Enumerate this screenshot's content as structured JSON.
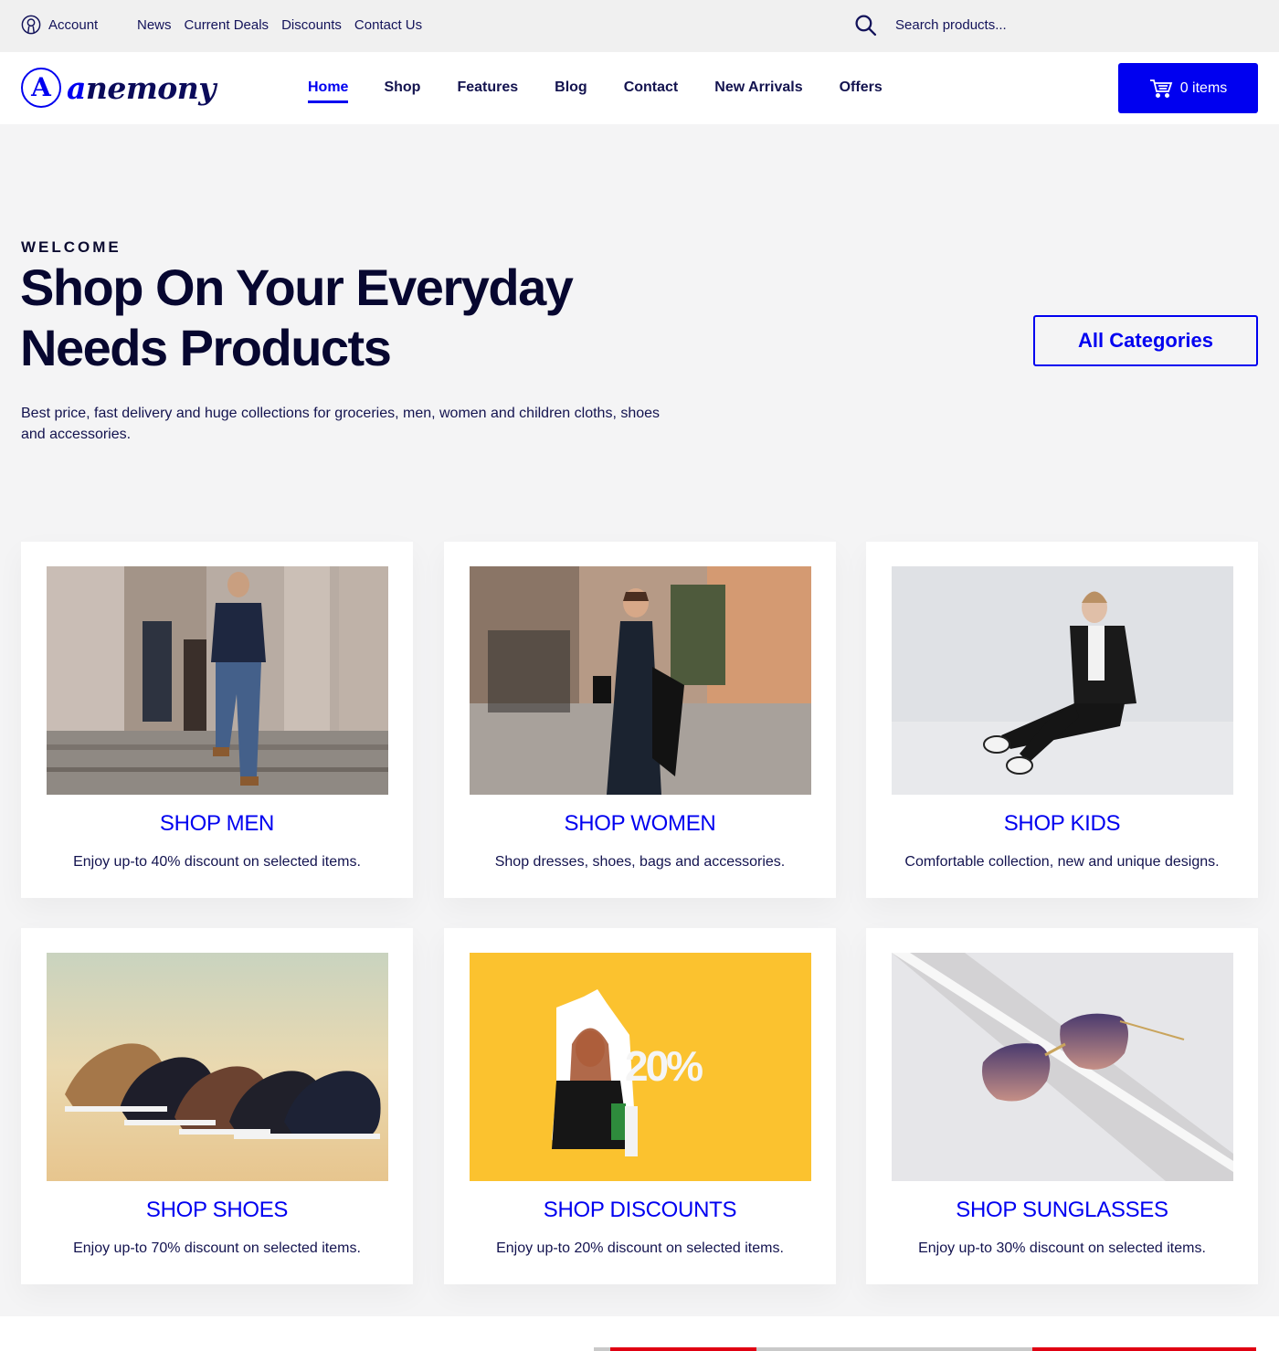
{
  "topbar": {
    "account_label": "Account",
    "links": [
      "News",
      "Current Deals",
      "Discounts",
      "Contact Us"
    ],
    "search_placeholder": "Search products..."
  },
  "header": {
    "logo_mark": "A",
    "logo_first": "a",
    "logo_rest": "nemony",
    "nav": [
      {
        "label": "Home",
        "active": true
      },
      {
        "label": "Shop",
        "active": false
      },
      {
        "label": "Features",
        "active": false
      },
      {
        "label": "Blog",
        "active": false
      },
      {
        "label": "Contact",
        "active": false
      },
      {
        "label": "New Arrivals",
        "active": false
      },
      {
        "label": "Offers",
        "active": false
      }
    ],
    "cart_label": "0 items"
  },
  "hero": {
    "eyebrow": "WELCOME",
    "title_line1": "Shop On Your Everyday",
    "title_line2": "Needs Products",
    "description": "Best price, fast delivery and huge collections for groceries, men, women and children cloths, shoes and accessories.",
    "cta_label": "All Categories"
  },
  "categories": [
    {
      "title": "SHOP MEN",
      "description": "Enjoy up-to 40% discount on selected items.",
      "image": "man walking down stone steps in blazer and jeans"
    },
    {
      "title": "SHOP WOMEN",
      "description": "Shop dresses, shoes, bags and accessories.",
      "image": "woman in sunglasses and dark dress on city street"
    },
    {
      "title": "SHOP KIDS",
      "description": "Comfortable collection, new and unique designs.",
      "image": "girl in black suit sitting on floor"
    },
    {
      "title": "SHOP SHOES",
      "description": "Enjoy up-to 70% discount on selected items.",
      "image": "row of five sneakers"
    },
    {
      "title": "SHOP DISCOUNTS",
      "description": "Enjoy up-to 20% discount on selected items.",
      "image": "woman with shopping bags through torn yellow paper",
      "image_text": "20%"
    },
    {
      "title": "SHOP SUNGLASSES",
      "description": "Enjoy up-to 30% discount on selected items.",
      "image": "purple gradient rimless sunglasses"
    }
  ],
  "colors": {
    "accent": "#0000f0",
    "text_dark": "#0b0b45",
    "page_bg": "#f4f4f5"
  }
}
